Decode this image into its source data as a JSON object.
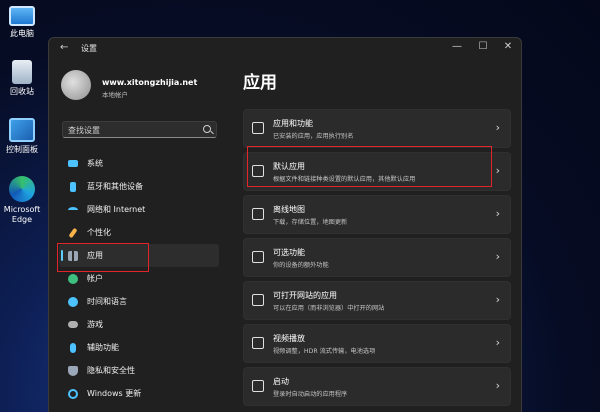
{
  "desktop": {
    "icons": [
      {
        "label": "此电脑",
        "icon": "monitor-icon"
      },
      {
        "label": "回收站",
        "icon": "recycle-bin-icon"
      },
      {
        "label": "控制面板",
        "icon": "control-panel-icon"
      },
      {
        "label": "Microsoft Edge",
        "icon": "edge-icon"
      }
    ]
  },
  "window": {
    "title": "设置",
    "back_glyph": "←",
    "controls": {
      "minimize": "—",
      "maximize": "☐",
      "close": "✕"
    }
  },
  "user": {
    "name": "www.xitongzhijia.net",
    "account": "本地帐户"
  },
  "search": {
    "placeholder": "查找设置"
  },
  "sidebar": {
    "items": [
      {
        "label": "系统",
        "icon": "system-icon",
        "color": "#4cc2ff"
      },
      {
        "label": "蓝牙和其他设备",
        "icon": "bluetooth-icon",
        "color": "#4cc2ff"
      },
      {
        "label": "网络和 Internet",
        "icon": "wifi-icon",
        "color": "#4cc2ff"
      },
      {
        "label": "个性化",
        "icon": "brush-icon",
        "color": "#f7b24a"
      },
      {
        "label": "应用",
        "icon": "apps-icon",
        "color": "#9aa7b8",
        "active": true
      },
      {
        "label": "帐户",
        "icon": "account-icon",
        "color": "#3fbf7f"
      },
      {
        "label": "时间和语言",
        "icon": "globe-clock-icon",
        "color": "#4cc2ff"
      },
      {
        "label": "游戏",
        "icon": "gamepad-icon",
        "color": "#b0b0b0"
      },
      {
        "label": "辅助功能",
        "icon": "accessibility-icon",
        "color": "#4cc2ff"
      },
      {
        "label": "隐私和安全性",
        "icon": "shield-icon",
        "color": "#9aa7b8"
      },
      {
        "label": "Windows 更新",
        "icon": "update-icon",
        "color": "#4cc2ff"
      }
    ]
  },
  "main": {
    "title": "应用",
    "cards": [
      {
        "title": "应用和功能",
        "subtitle": "已安装的应用，应用执行别名",
        "icon": "apps-list-icon"
      },
      {
        "title": "默认应用",
        "subtitle": "根据文件和链接种类设置的默认应用，其他默认应用",
        "icon": "default-apps-icon"
      },
      {
        "title": "离线地图",
        "subtitle": "下载，存储位置，地图更新",
        "icon": "map-icon"
      },
      {
        "title": "可选功能",
        "subtitle": "你的设备的额外功能",
        "icon": "optional-features-icon"
      },
      {
        "title": "可打开网站的应用",
        "subtitle": "可以在应用（而非浏览器）中打开的网站",
        "icon": "web-apps-icon"
      },
      {
        "title": "视频播放",
        "subtitle": "视频调整，HDR 流式传输，电池选项",
        "icon": "video-icon"
      },
      {
        "title": "启动",
        "subtitle": "登录时自动启动的应用程序",
        "icon": "startup-icon"
      }
    ],
    "chevron": "›"
  },
  "colors": {
    "accent": "#60cdff",
    "highlight": "#e0262a"
  }
}
